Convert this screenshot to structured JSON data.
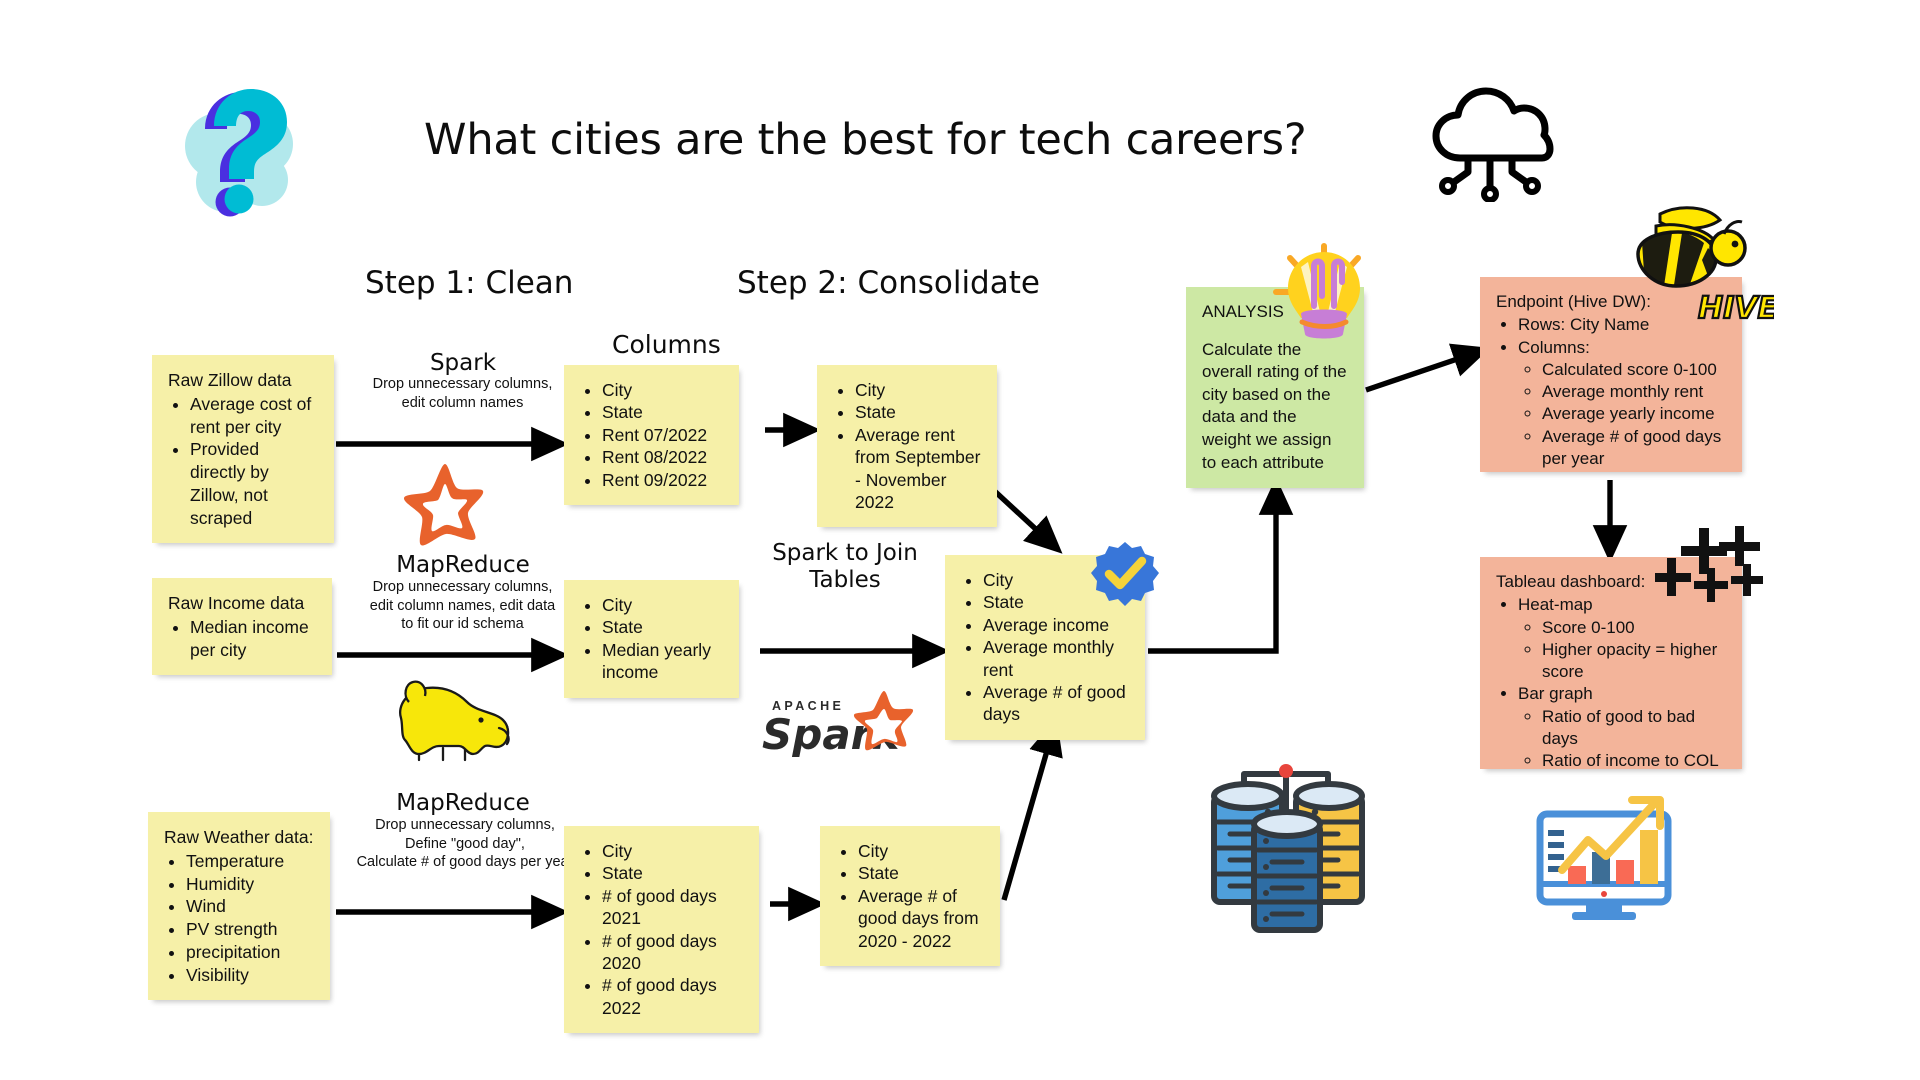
{
  "page": {
    "title": "What cities are the best for tech careers?",
    "background_color": "#ffffff"
  },
  "colors": {
    "note_yellow": "#f6f0a8",
    "note_green": "#cde8a4",
    "note_salmon": "#f3b49a",
    "arrow_black": "#000000",
    "spark_orange": "#e8622c",
    "hive_yellow": "#ffe600",
    "verified_blue": "#3876d9",
    "tableau_black": "#111111",
    "question_teal": "#00bcd4",
    "question_purple": "#4a2fe0"
  },
  "steps": {
    "step1_label": "Step 1: Clean",
    "step2_label": "Step 2: Consolidate",
    "columns_label": "Columns"
  },
  "processes": {
    "spark_zillow": {
      "name": "Spark",
      "description": "Drop unnecessary columns,\nedit column names"
    },
    "mapreduce_income": {
      "name": "MapReduce",
      "description": "Drop unnecessary columns,\nedit column names, edit data\nto fit our id schema"
    },
    "mapreduce_weather": {
      "name": "MapReduce",
      "description": "Drop unnecessary columns,\nDefine \"good day\",\nCalculate # of good days per year"
    },
    "spark_join": {
      "name": "Spark to Join Tables"
    }
  },
  "notes": {
    "raw_zillow": {
      "lead": "Raw Zillow data",
      "items": [
        "Average cost of rent per city",
        "Provided directly by Zillow, not scraped"
      ]
    },
    "raw_income": {
      "lead": "Raw Income data",
      "items": [
        "Median income per city"
      ]
    },
    "raw_weather": {
      "lead": "Raw Weather data:",
      "items": [
        "Temperature",
        "Humidity",
        "Wind",
        "PV strength",
        "precipitation",
        "Visibility"
      ]
    },
    "zillow_columns": {
      "items": [
        "City",
        "State",
        "Rent 07/2022",
        "Rent 08/2022",
        "Rent 09/2022"
      ]
    },
    "zillow_consolidated": {
      "items": [
        "City",
        "State",
        "Average rent from September - November 2022"
      ]
    },
    "income_columns": {
      "items": [
        "City",
        "State",
        "Median yearly income"
      ]
    },
    "weather_columns": {
      "items": [
        "City",
        "State",
        "# of good days 2021",
        "# of good days 2020",
        "# of good days 2022"
      ]
    },
    "weather_consolidated": {
      "items": [
        "City",
        "State",
        "Average # of good days from 2020 - 2022"
      ]
    },
    "joined_table": {
      "items": [
        "City",
        "State",
        "Average income",
        "Average monthly rent",
        "Average # of good days"
      ]
    },
    "analysis": {
      "heading": "ANALYSIS",
      "body": "Calculate the overall rating of the city based on the data and the weight we assign to each attribute"
    },
    "endpoint": {
      "lead": "Endpoint (Hive DW):",
      "items": [
        {
          "text": "Rows: City Name",
          "children": []
        },
        {
          "text": "Columns:",
          "children": [
            "Calculated score 0-100",
            "Average monthly rent",
            "Average yearly income",
            "Average # of good days per year"
          ]
        }
      ]
    },
    "tableau": {
      "lead": "Tableau dashboard:",
      "items": [
        {
          "text": "Heat-map",
          "children": [
            "Score 0-100",
            "Higher opacity = higher score"
          ]
        },
        {
          "text": "Bar graph",
          "children": [
            "Ratio of good to bad days",
            "Ratio of income to COL"
          ]
        }
      ]
    }
  },
  "logos": {
    "question_mark": "question-mark-icon",
    "cloud": "cloud-computing-icon",
    "spark_star_top": "spark-star-icon",
    "hadoop_elephant": "hadoop-elephant-icon",
    "apache_spark": "apache-spark-logo",
    "apache_spark_wordmark_small": "APACHE",
    "apache_spark_wordmark": "Spark",
    "hive_bee": "apache-hive-logo",
    "hive_wordmark": "HIVE",
    "lightbulb": "lightbulb-idea-icon",
    "verified_check": "verified-check-icon",
    "database_stack": "database-stack-icon",
    "tableau": "tableau-logo",
    "dashboard_chart": "dashboard-chart-icon"
  }
}
